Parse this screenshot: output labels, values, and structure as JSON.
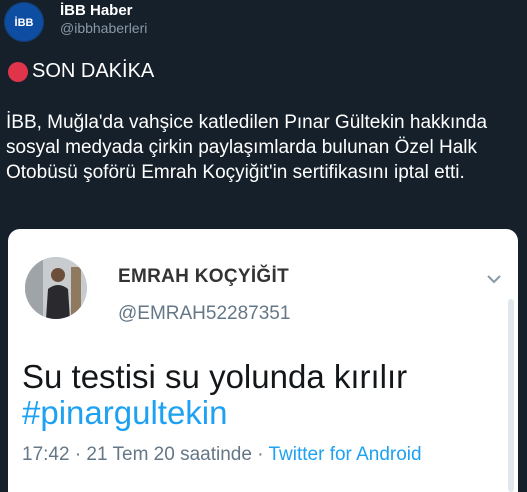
{
  "account": {
    "name": "İBB Haber",
    "handle": "@ibbhaberleri",
    "avatar_icon": "ibb-logo-icon",
    "avatar_text": "İBB"
  },
  "tweet": {
    "breaking_label": "SON DAKİKA",
    "text": "İBB, Muğla'da vahşice katledilen Pınar Gültekin hakkında sosyal medyada çirkin paylaşımlarda bulunan Özel Halk Otobüsü şoförü Emrah Koçyiğit'in sertifikasını iptal etti."
  },
  "embedded": {
    "name": "EMRAH KOÇYİĞİT",
    "handle": "@EMRAH52287351",
    "text": "Su testisi su yolunda kırılır",
    "hashtag": "#pinargultekin",
    "time": "17:42 · 21 Tem 20 saatinde · ",
    "source": "Twitter for Android"
  },
  "colors": {
    "background": "#15202b",
    "breaking_dot": "#e0344a",
    "link": "#1da1f2"
  }
}
